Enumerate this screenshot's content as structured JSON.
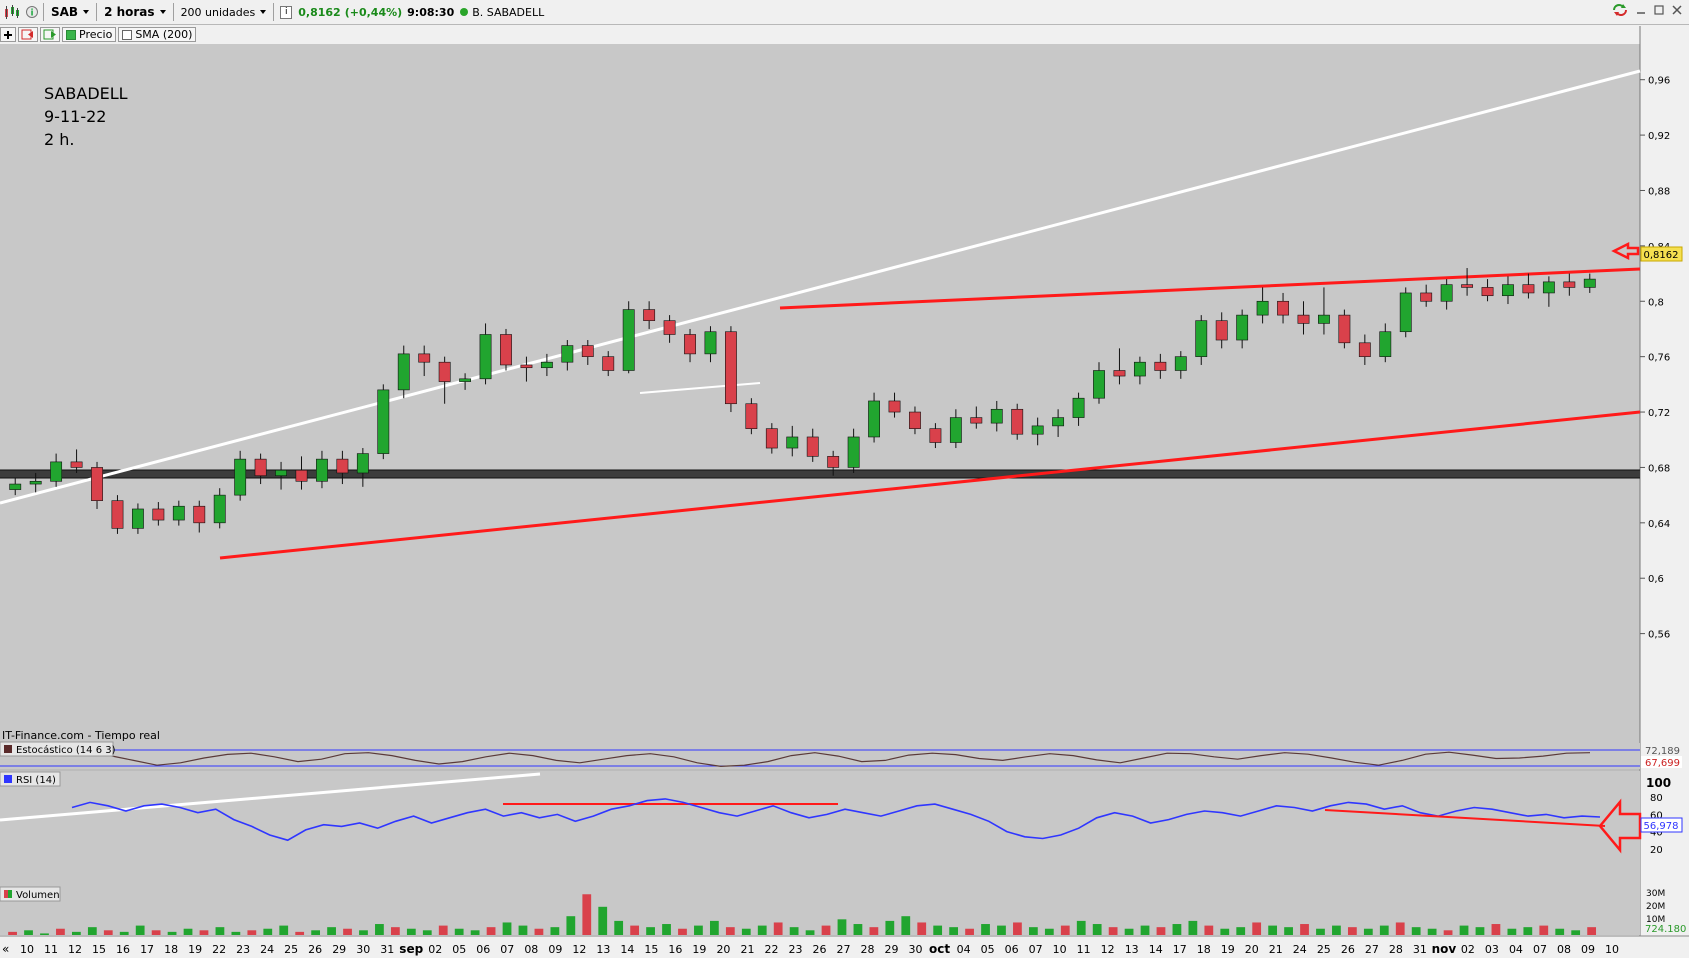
{
  "toolbar": {
    "symbol": "SAB",
    "timeframe": "2 horas",
    "units": "200 unidades",
    "quote_price": "0,8162",
    "quote_change": "(+0,44%)",
    "quote_time": "9:08:30",
    "instrument_name": "B. SABADELL"
  },
  "subtoolbar": {
    "price_label": "Precio",
    "sma_label": "SMA (200)"
  },
  "annotation": {
    "line1": "SABADELL",
    "line2": "9-11-22",
    "line3": "2 h."
  },
  "source_label": "IT-Finance.com - Tiempo real",
  "panels": {
    "stoch_label": "Estocástico (14 6 3)",
    "stoch_value1": "72,189",
    "stoch_value2": "67,699",
    "rsi_label": "RSI (14)",
    "rsi_value": "56,978",
    "volume_label": "Volumen",
    "volume_value": "724.180"
  },
  "price_axis": {
    "ticks": [
      "0,96",
      "0,92",
      "0,88",
      "0,84",
      "0,8",
      "0,76",
      "0,72",
      "0,68",
      "0,64",
      "0,6",
      "0,56"
    ],
    "current_label": "0,8162"
  },
  "rsi_axis": {
    "ticks": [
      "100",
      "80",
      "60",
      "40",
      "20"
    ]
  },
  "volume_axis": {
    "ticks": [
      "30M",
      "20M",
      "10M"
    ]
  },
  "time_axis": {
    "nav_left": "«",
    "labels": [
      "10",
      "11",
      "12",
      "15",
      "16",
      "17",
      "18",
      "19",
      "22",
      "23",
      "24",
      "25",
      "26",
      "29",
      "30",
      "31",
      "sep",
      "02",
      "05",
      "06",
      "07",
      "08",
      "09",
      "12",
      "13",
      "14",
      "15",
      "16",
      "19",
      "20",
      "21",
      "22",
      "23",
      "26",
      "27",
      "28",
      "29",
      "30",
      "oct",
      "04",
      "05",
      "06",
      "07",
      "10",
      "11",
      "12",
      "13",
      "14",
      "17",
      "18",
      "19",
      "20",
      "21",
      "24",
      "25",
      "26",
      "27",
      "28",
      "31",
      "nov",
      "02",
      "03",
      "04",
      "07",
      "08",
      "09",
      "10"
    ]
  },
  "colors": {
    "chart_bg": "#c8c8c8",
    "candle_up": "#21a52f",
    "candle_down": "#d9414b",
    "trend_red": "#ff1a1a",
    "trend_white": "#ffffff",
    "support_band": "#3c3c3c",
    "rsi_line": "#2f36ff",
    "price_marker_bg": "#f5e050"
  },
  "chart_data": [
    {
      "type": "candlestick",
      "title": "",
      "xlabel": "",
      "ylabel": "",
      "ylim": [
        0.52,
        0.98
      ],
      "series": [
        {
          "values": [
            [
              0.664,
              0.672,
              0.66,
              0.668
            ],
            [
              0.668,
              0.676,
              0.662,
              0.67
            ],
            [
              0.67,
              0.69,
              0.666,
              0.684
            ],
            [
              0.684,
              0.693,
              0.676,
              0.68
            ],
            [
              0.68,
              0.684,
              0.65,
              0.656
            ],
            [
              0.656,
              0.66,
              0.632,
              0.636
            ],
            [
              0.636,
              0.654,
              0.632,
              0.65
            ],
            [
              0.65,
              0.655,
              0.638,
              0.642
            ],
            [
              0.642,
              0.656,
              0.638,
              0.652
            ],
            [
              0.652,
              0.656,
              0.633,
              0.64
            ],
            [
              0.64,
              0.665,
              0.636,
              0.66
            ],
            [
              0.66,
              0.692,
              0.656,
              0.686
            ],
            [
              0.686,
              0.69,
              0.668,
              0.674
            ],
            [
              0.674,
              0.684,
              0.664,
              0.678
            ],
            [
              0.678,
              0.688,
              0.664,
              0.67
            ],
            [
              0.67,
              0.692,
              0.665,
              0.686
            ],
            [
              0.686,
              0.692,
              0.668,
              0.676
            ],
            [
              0.676,
              0.694,
              0.666,
              0.69
            ],
            [
              0.69,
              0.74,
              0.686,
              0.736
            ],
            [
              0.736,
              0.768,
              0.73,
              0.762
            ],
            [
              0.762,
              0.768,
              0.746,
              0.756
            ],
            [
              0.756,
              0.76,
              0.726,
              0.742
            ],
            [
              0.742,
              0.748,
              0.736,
              0.744
            ],
            [
              0.744,
              0.784,
              0.74,
              0.776
            ],
            [
              0.776,
              0.78,
              0.75,
              0.754
            ],
            [
              0.754,
              0.76,
              0.742,
              0.752
            ],
            [
              0.752,
              0.762,
              0.746,
              0.756
            ],
            [
              0.756,
              0.772,
              0.75,
              0.768
            ],
            [
              0.768,
              0.772,
              0.754,
              0.76
            ],
            [
              0.76,
              0.764,
              0.746,
              0.75
            ],
            [
              0.75,
              0.8,
              0.748,
              0.794
            ],
            [
              0.794,
              0.8,
              0.78,
              0.786
            ],
            [
              0.786,
              0.79,
              0.77,
              0.776
            ],
            [
              0.776,
              0.78,
              0.756,
              0.762
            ],
            [
              0.762,
              0.782,
              0.756,
              0.778
            ],
            [
              0.778,
              0.782,
              0.72,
              0.726
            ],
            [
              0.726,
              0.73,
              0.704,
              0.708
            ],
            [
              0.708,
              0.712,
              0.69,
              0.694
            ],
            [
              0.694,
              0.71,
              0.688,
              0.702
            ],
            [
              0.702,
              0.708,
              0.684,
              0.688
            ],
            [
              0.688,
              0.692,
              0.674,
              0.68
            ],
            [
              0.68,
              0.708,
              0.676,
              0.702
            ],
            [
              0.702,
              0.734,
              0.698,
              0.728
            ],
            [
              0.728,
              0.734,
              0.716,
              0.72
            ],
            [
              0.72,
              0.724,
              0.704,
              0.708
            ],
            [
              0.708,
              0.712,
              0.694,
              0.698
            ],
            [
              0.698,
              0.722,
              0.694,
              0.716
            ],
            [
              0.716,
              0.724,
              0.708,
              0.712
            ],
            [
              0.712,
              0.728,
              0.706,
              0.722
            ],
            [
              0.722,
              0.726,
              0.7,
              0.704
            ],
            [
              0.704,
              0.716,
              0.696,
              0.71
            ],
            [
              0.71,
              0.722,
              0.702,
              0.716
            ],
            [
              0.716,
              0.734,
              0.71,
              0.73
            ],
            [
              0.73,
              0.756,
              0.726,
              0.75
            ],
            [
              0.75,
              0.766,
              0.74,
              0.746
            ],
            [
              0.746,
              0.76,
              0.74,
              0.756
            ],
            [
              0.756,
              0.762,
              0.744,
              0.75
            ],
            [
              0.75,
              0.764,
              0.744,
              0.76
            ],
            [
              0.76,
              0.79,
              0.754,
              0.786
            ],
            [
              0.786,
              0.792,
              0.766,
              0.772
            ],
            [
              0.772,
              0.794,
              0.766,
              0.79
            ],
            [
              0.79,
              0.81,
              0.784,
              0.8
            ],
            [
              0.8,
              0.806,
              0.784,
              0.79
            ],
            [
              0.79,
              0.8,
              0.776,
              0.784
            ],
            [
              0.784,
              0.81,
              0.776,
              0.79
            ],
            [
              0.79,
              0.794,
              0.766,
              0.77
            ],
            [
              0.77,
              0.776,
              0.754,
              0.76
            ],
            [
              0.76,
              0.784,
              0.756,
              0.778
            ],
            [
              0.778,
              0.81,
              0.774,
              0.806
            ],
            [
              0.806,
              0.812,
              0.796,
              0.8
            ],
            [
              0.8,
              0.816,
              0.794,
              0.812
            ],
            [
              0.812,
              0.824,
              0.804,
              0.81
            ],
            [
              0.81,
              0.816,
              0.8,
              0.804
            ],
            [
              0.804,
              0.818,
              0.798,
              0.812
            ],
            [
              0.812,
              0.82,
              0.802,
              0.806
            ],
            [
              0.806,
              0.818,
              0.796,
              0.814
            ],
            [
              0.814,
              0.82,
              0.804,
              0.81
            ],
            [
              0.81,
              0.82,
              0.806,
              0.816
            ]
          ]
        }
      ]
    },
    {
      "type": "line",
      "title": "",
      "ylabel": "",
      "ylim": [
        0,
        100
      ],
      "series": [
        {
          "values": [
            68,
            74,
            70,
            64,
            70,
            72,
            68,
            62,
            66,
            54,
            46,
            36,
            30,
            42,
            48,
            46,
            50,
            44,
            52,
            58,
            50,
            56,
            62,
            66,
            58,
            62,
            56,
            60,
            52,
            58,
            66,
            70,
            76,
            78,
            74,
            68,
            62,
            58,
            64,
            70,
            62,
            56,
            60,
            66,
            62,
            58,
            64,
            70,
            72,
            66,
            60,
            52,
            40,
            34,
            32,
            36,
            44,
            56,
            62,
            58,
            50,
            54,
            60,
            64,
            62,
            58,
            64,
            70,
            68,
            64,
            70,
            74,
            72,
            66,
            70,
            62,
            58,
            64,
            68,
            66,
            62,
            58,
            60,
            56,
            58,
            57
          ]
        }
      ]
    },
    {
      "type": "line",
      "title": "",
      "ylabel": "",
      "ylim": [
        0,
        100
      ],
      "series": [
        {
          "values": [
            60,
            40,
            20,
            30,
            50,
            65,
            70,
            55,
            35,
            45,
            68,
            72,
            60,
            40,
            25,
            35,
            55,
            70,
            60,
            40,
            30,
            45,
            60,
            68,
            55,
            30,
            15,
            20,
            35,
            60,
            72,
            58,
            35,
            40,
            62,
            70,
            64,
            48,
            40,
            55,
            68,
            60,
            42,
            30,
            50,
            70,
            68,
            55,
            45,
            60,
            72,
            66,
            50,
            32,
            20,
            40,
            66,
            74,
            62,
            48,
            50,
            58,
            70,
            72
          ]
        }
      ]
    },
    {
      "type": "bar",
      "title": "",
      "ylabel": "",
      "ylim": [
        0,
        30
      ],
      "values": [
        2,
        3,
        1,
        4,
        2,
        5,
        3,
        2,
        6,
        3,
        2,
        4,
        3,
        5,
        2,
        3,
        4,
        6,
        2,
        3,
        5,
        4,
        3,
        7,
        5,
        4,
        3,
        6,
        4,
        3,
        5,
        8,
        6,
        4,
        5,
        12,
        26,
        18,
        9,
        6,
        5,
        7,
        4,
        6,
        9,
        5,
        4,
        6,
        8,
        5,
        3,
        6,
        10,
        7,
        5,
        9,
        12,
        8,
        6,
        5,
        4,
        7,
        6,
        8,
        5,
        4,
        6,
        9,
        7,
        5,
        4,
        6,
        5,
        7,
        9,
        6,
        4,
        5,
        8,
        6,
        5,
        7,
        4,
        6,
        5,
        4,
        6,
        8,
        5,
        4,
        3,
        6,
        5,
        7,
        4,
        5,
        6,
        4,
        3,
        5
      ]
    }
  ]
}
